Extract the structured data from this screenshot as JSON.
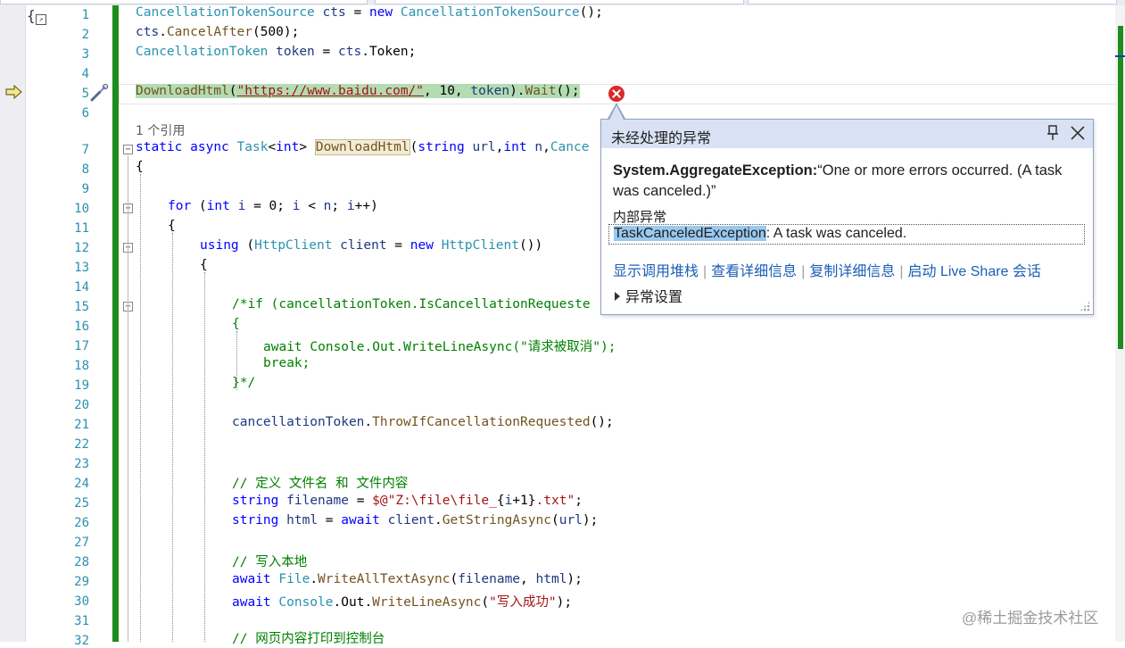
{
  "editor": {
    "line_numbers": [
      "1",
      "2",
      "3",
      "4",
      "5",
      "6",
      "7",
      "8",
      "9",
      "10",
      "11",
      "12",
      "13",
      "14",
      "15",
      "16",
      "17",
      "18",
      "19",
      "20",
      "21",
      "22",
      "23",
      "24",
      "25",
      "26",
      "27",
      "28",
      "29",
      "30",
      "31",
      "32"
    ],
    "reference_count": "1 个引用",
    "lines": {
      "l1": [
        "CancellationTokenSource",
        " ",
        "cts",
        " = ",
        "new",
        " ",
        "CancellationTokenSource",
        "();"
      ],
      "l2": [
        "cts",
        ".",
        "CancelAfter",
        "(500);"
      ],
      "l3": [
        "CancellationToken",
        " ",
        "token",
        " = ",
        "cts",
        ".",
        "Token",
        ";"
      ],
      "l5": [
        "DownloadHtml",
        "(",
        "\"https://www.baidu.com/\"",
        ", 10, ",
        "token",
        ").",
        "Wait",
        "();"
      ],
      "l7": [
        "static",
        " ",
        "async",
        " ",
        "Task",
        "<",
        "int",
        "> ",
        "DownloadHtml",
        "(",
        "string",
        " ",
        "url",
        ",",
        "int",
        " ",
        "n",
        ",",
        "Cance"
      ],
      "l8": [
        "{"
      ],
      "l10": [
        "for",
        " (",
        "int",
        " ",
        "i",
        " = 0; ",
        "i",
        " < ",
        "n",
        "; ",
        "i",
        "++)"
      ],
      "l11": [
        "{"
      ],
      "l12": [
        "using",
        " (",
        "HttpClient",
        " ",
        "client",
        " = ",
        "new",
        " ",
        "HttpClient",
        "())"
      ],
      "l13": [
        "{"
      ],
      "l15": [
        "/*if (cancellationToken.IsCancellationRequeste"
      ],
      "l16": [
        "{"
      ],
      "l17": [
        "await Console.Out.WriteLineAsync(\"请求被取消\");"
      ],
      "l18": [
        "break;"
      ],
      "l19": [
        "}*/"
      ],
      "l21": [
        "cancellationToken",
        ".",
        "ThrowIfCancellationRequested",
        "();"
      ],
      "l24": [
        "// 定义 文件名 和 文件内容"
      ],
      "l25": [
        "string",
        " ",
        "filename",
        " = ",
        "$@\"Z:\\file\\file_",
        "{",
        "i",
        "+1}",
        ".txt\"",
        ";"
      ],
      "l26": [
        "string",
        " ",
        "html",
        " = ",
        "await",
        " ",
        "client",
        ".",
        "GetStringAsync",
        "(",
        "url",
        ");"
      ],
      "l28": [
        "// 写入本地"
      ],
      "l29": [
        "await",
        " ",
        "File",
        ".",
        "WriteAllTextAsync",
        "(",
        "filename",
        ", ",
        "html",
        ");"
      ],
      "l30": [
        "await",
        " ",
        "Console",
        ".",
        "Out",
        ".",
        "WriteLineAsync",
        "(",
        "\"写入成功\"",
        ");"
      ],
      "l32": [
        "// 网页内容打印到控制台"
      ]
    }
  },
  "exception_popup": {
    "title": "未经处理的异常",
    "exception_type": "System.AggregateException:",
    "exception_message": "“One or more errors occurred. (A task was canceled.)”",
    "inner_label": "内部异常",
    "inner_type": "TaskCanceledException",
    "inner_message": ": A task was canceled.",
    "links": [
      "显示调用堆栈",
      "查看详细信息",
      "复制详细信息",
      "启动 Live Share 会话"
    ],
    "settings_label": "异常设置"
  },
  "watermark": "@稀土掘金技术社区",
  "colors": {
    "keyword": "#0000ff",
    "type": "#2b91af",
    "method": "#74531f",
    "string": "#a31515",
    "comment": "#008000",
    "error": "#d92a2a",
    "link": "#1a5fb4",
    "change_bar": "#1e8c1e"
  }
}
